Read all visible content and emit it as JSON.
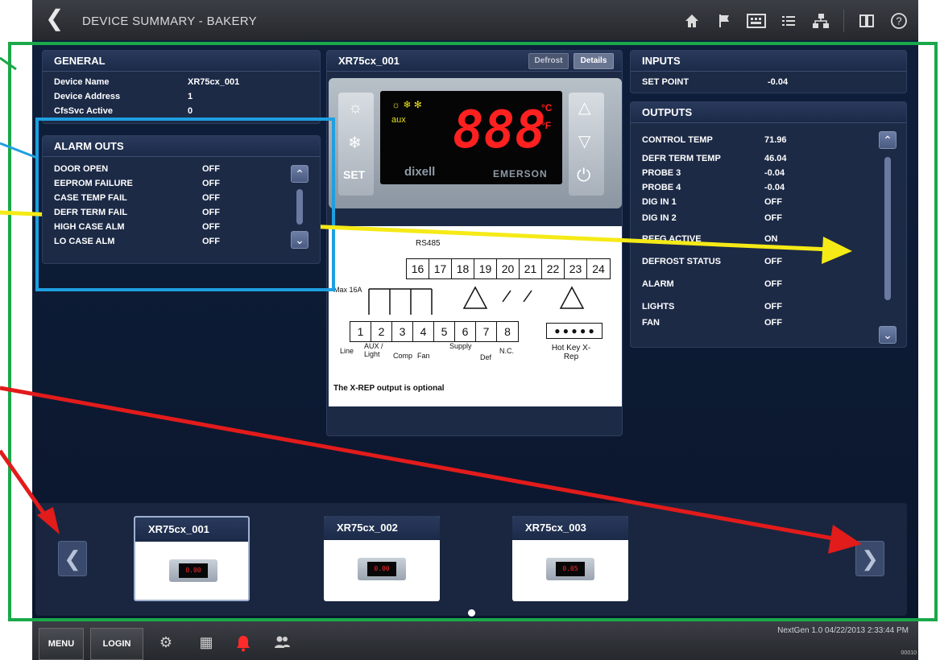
{
  "header": {
    "title": "DEVICE SUMMARY - BAKERY",
    "back_icon": "chevron-left-icon"
  },
  "toolbar_icons": [
    "home-icon",
    "flag-icon",
    "calendar-keyboard-icon",
    "list-icon",
    "network-icon",
    "book-icon",
    "help-icon"
  ],
  "general": {
    "title": "GENERAL",
    "rows": [
      {
        "label": "Device Name",
        "value": "XR75cx_001"
      },
      {
        "label": "Device Address",
        "value": "1"
      },
      {
        "label": "CfsSvc Active",
        "value": "0"
      }
    ]
  },
  "alarm_outs": {
    "title": "ALARM OUTS",
    "rows": [
      {
        "label": "DOOR OPEN",
        "value": "OFF"
      },
      {
        "label": "EEPROM FAILURE",
        "value": "OFF"
      },
      {
        "label": "CASE TEMP FAIL",
        "value": "OFF"
      },
      {
        "label": "DEFR TERM FAIL",
        "value": "OFF"
      },
      {
        "label": "HIGH CASE ALM",
        "value": "OFF"
      },
      {
        "label": "LO CASE ALM",
        "value": "OFF"
      }
    ]
  },
  "device": {
    "title": "XR75cx_001",
    "defrost_label": "Defrost",
    "details_label": "Details",
    "display_value": "888",
    "unit_c": "°C",
    "unit_f": "°F",
    "brand": "dixell",
    "maker": "EMERSON",
    "set_label": "SET",
    "aux_label": "aux",
    "diagram": {
      "top_label": "RS485",
      "top_terminals": [
        "16",
        "17",
        "18",
        "19",
        "20",
        "21",
        "22",
        "23",
        "24"
      ],
      "bottom_terminals": [
        "1",
        "2",
        "3",
        "4",
        "5",
        "6",
        "7",
        "8"
      ],
      "max_label": "Max 16A",
      "labels": [
        "Line",
        "AUX / Light",
        "Comp",
        "Fan",
        "Supply",
        "Def",
        "N.C.",
        "Hot Key X-Rep"
      ],
      "note": "The X-REP output is optional"
    }
  },
  "inputs": {
    "title": "INPUTS",
    "rows": [
      {
        "label": "SET POINT",
        "value": "-0.04"
      }
    ]
  },
  "outputs": {
    "title": "OUTPUTS",
    "rows": [
      {
        "label": "CONTROL TEMP",
        "value": "71.96"
      },
      {
        "label": "DEFR TERM TEMP",
        "value": "46.04"
      },
      {
        "label": "PROBE 3",
        "value": "-0.04"
      },
      {
        "label": "PROBE 4",
        "value": "-0.04"
      },
      {
        "label": "DIG IN 1",
        "value": "OFF"
      },
      {
        "label": "DIG IN 2",
        "value": "OFF"
      },
      {
        "label": "REFG ACTIVE",
        "value": "ON"
      },
      {
        "label": "DEFROST STATUS",
        "value": "OFF"
      },
      {
        "label": "ALARM",
        "value": "OFF"
      },
      {
        "label": "LIGHTS",
        "value": "OFF"
      },
      {
        "label": "FAN",
        "value": "OFF"
      }
    ]
  },
  "carousel": {
    "cards": [
      {
        "name": "XR75cx_001",
        "display": "0.00"
      },
      {
        "name": "XR75cx_002",
        "display": "0.00"
      },
      {
        "name": "XR75cx_003",
        "display": "0.05"
      }
    ]
  },
  "footer": {
    "menu_label": "MENU",
    "login_label": "LOGIN",
    "status": "NextGen 1.0 04/22/2013 2:33:44 PM",
    "tiny_text": "00010"
  },
  "colors": {
    "annotation_green": "#1aa84a",
    "annotation_blue": "#1e9fe0",
    "annotation_yellow": "#f5ea16",
    "annotation_red": "#e21b1b",
    "lcd_red": "#ff2020"
  }
}
